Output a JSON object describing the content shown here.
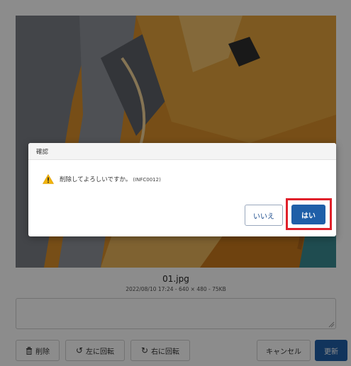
{
  "photo": {
    "file_name": "01.jpg",
    "file_meta": "2022/08/10 17:24 - 640 × 480 - 75KB"
  },
  "comment": {
    "value": "",
    "placeholder": ""
  },
  "actions": {
    "delete_label": "削除",
    "rotate_left_label": "左に回転",
    "rotate_right_label": "右に回転",
    "cancel_label": "キャンセル",
    "update_label": "更新"
  },
  "dialog": {
    "title": "確認",
    "message": "削除してよろしいですか。",
    "code": "(INFC0012)",
    "no_label": "いいえ",
    "yes_label": "はい"
  },
  "colors": {
    "primary": "#1f5fa8",
    "highlight": "#e0202a",
    "warning": "#f2b40a"
  },
  "icons": {
    "delete": "trash-icon",
    "rotate_left": "rotate-left-icon",
    "rotate_right": "rotate-right-icon",
    "warning": "warning-icon"
  }
}
